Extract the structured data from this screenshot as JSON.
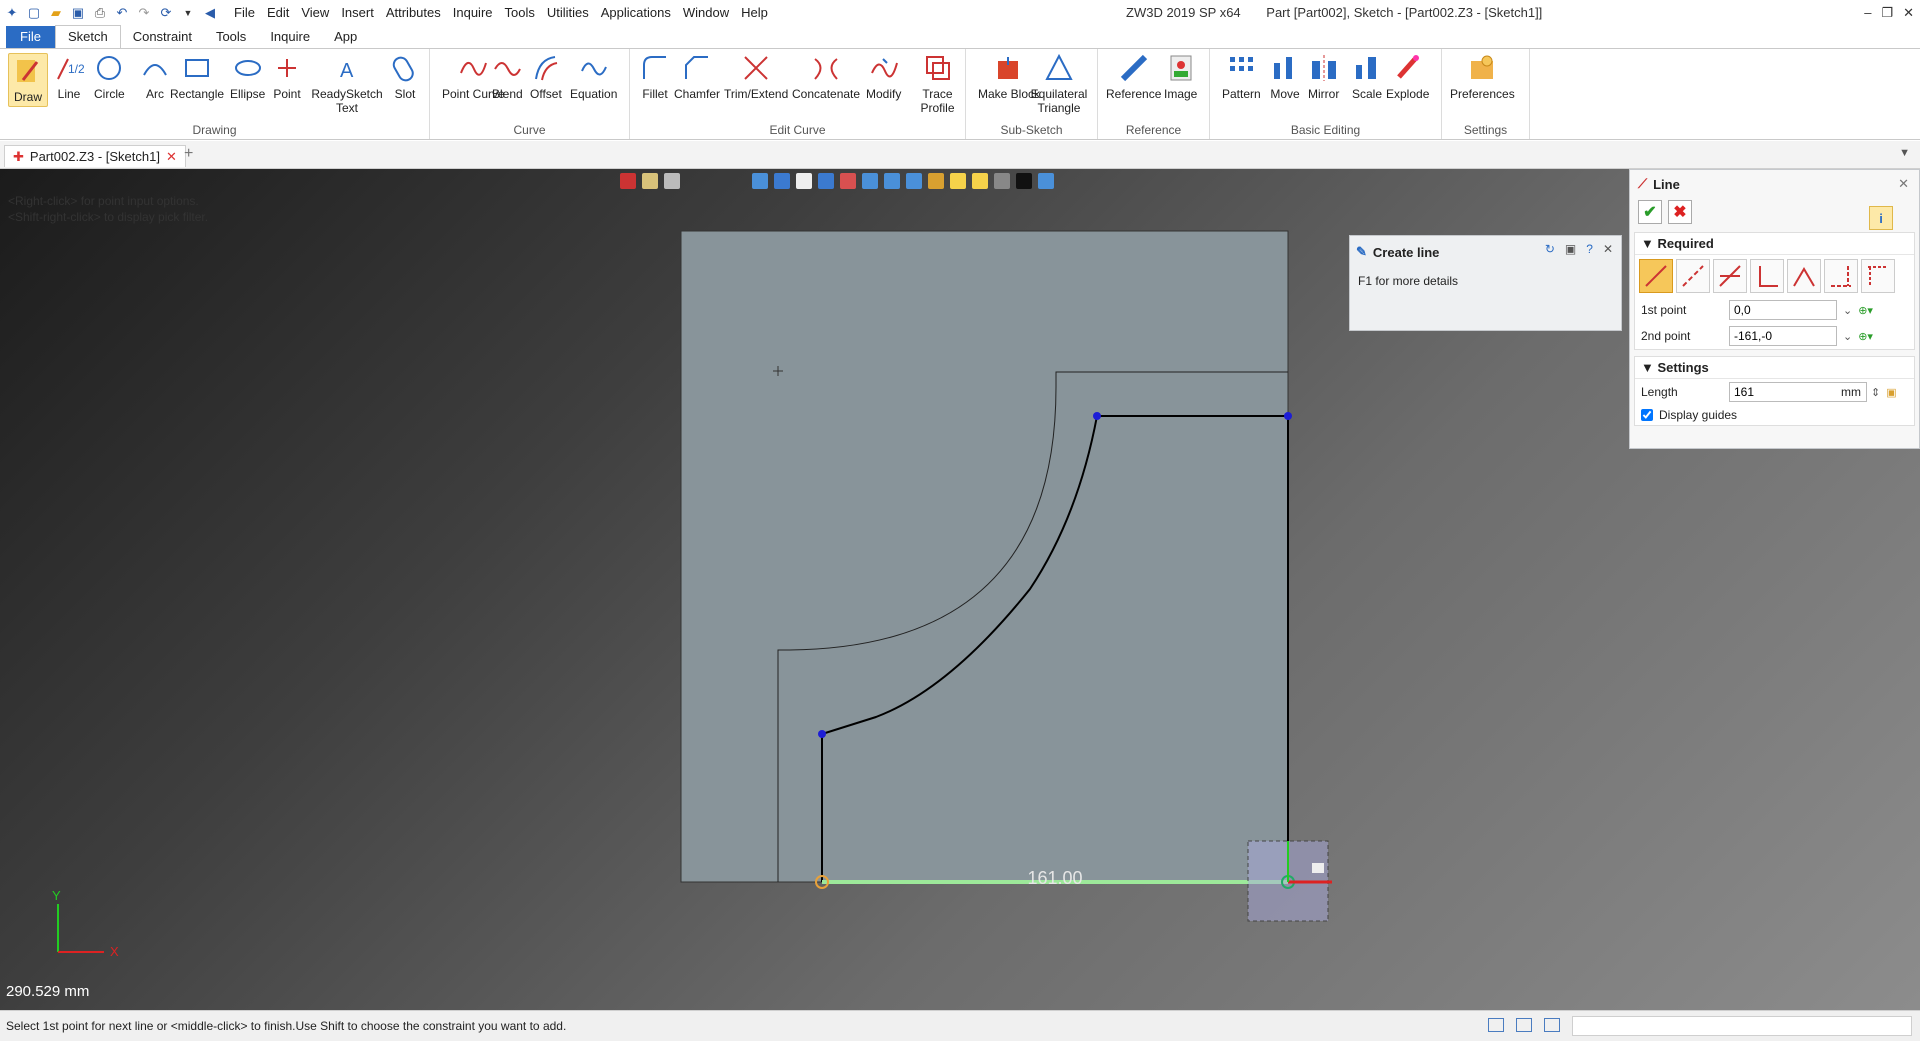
{
  "quick_access": [
    "logo",
    "new",
    "open",
    "save",
    "print",
    "undo",
    "redo",
    "select"
  ],
  "menu": [
    "File",
    "Edit",
    "View",
    "Insert",
    "Attributes",
    "Inquire",
    "Tools",
    "Utilities",
    "Applications",
    "Window",
    "Help"
  ],
  "window": {
    "app": "ZW3D 2019 SP x64",
    "doc": "Part [Part002],  Sketch - [Part002.Z3 - [Sketch1]]"
  },
  "ribbon_tabs": [
    "File",
    "Sketch",
    "Constraint",
    "Tools",
    "Inquire",
    "App"
  ],
  "ribbon_groups": {
    "drawing": {
      "title": "Drawing",
      "buttons": [
        "Draw",
        "Line",
        "Circle",
        "Arc",
        "Rectangle",
        "Ellipse",
        "Point",
        "ReadySketch Text",
        "Slot"
      ]
    },
    "curve": {
      "title": "Curve",
      "buttons": [
        "Point Curve",
        "Blend",
        "Offset",
        "Equation"
      ]
    },
    "edit_curve": {
      "title": "Edit Curve",
      "buttons": [
        "Fillet",
        "Chamfer",
        "Trim/Extend",
        "Concatenate",
        "Modify",
        "Trace Profile"
      ]
    },
    "sub_sketch": {
      "title": "Sub-Sketch",
      "buttons": [
        "Make Block",
        "Equilateral Triangle"
      ]
    },
    "reference": {
      "title": "Reference",
      "buttons": [
        "Reference",
        "Image"
      ]
    },
    "basic_editing": {
      "title": "Basic Editing",
      "buttons": [
        "Pattern",
        "Move",
        "Mirror",
        "Scale",
        "Explode"
      ]
    },
    "settings": {
      "title": "Settings",
      "buttons": [
        "Preferences"
      ]
    }
  },
  "doc_tab": "Part002.Z3 - [Sketch1]",
  "viewport": {
    "hint1": "<Right-click> for point input options.",
    "hint2": "<Shift-right-click> to display pick filter.",
    "dimension": "161.00",
    "measure": "290.529 mm",
    "axis_x": "X",
    "axis_y": "Y"
  },
  "create_line": {
    "title": "Create line",
    "details": "F1 for more details"
  },
  "line_panel": {
    "title": "Line",
    "required": "Required",
    "first_point_label": "1st point",
    "first_point": "0,0",
    "second_point_label": "2nd point",
    "second_point": "-161,-0",
    "settings": "Settings",
    "length_label": "Length",
    "length": "161",
    "unit": "mm",
    "display_guides": "Display guides"
  },
  "status": "Select 1st point for next line or <middle-click> to finish.Use Shift to choose the constraint you want to add.",
  "colors": {
    "accent": "#2b6cc4",
    "ok": "#2a9d2a",
    "cancel": "#dd2222",
    "preview": "#9de89a",
    "sketch_face": "#88949a"
  }
}
